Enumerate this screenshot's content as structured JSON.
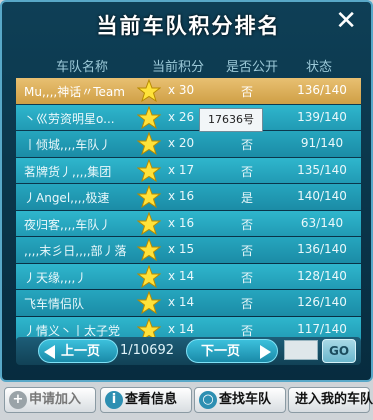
{
  "window": {
    "title": "当前车队积分排名",
    "close_label": "✕"
  },
  "header": {
    "name": "车队名称",
    "score": "当前积分",
    "public": "是否公开",
    "status": "状态"
  },
  "rows": [
    {
      "name": "Mu,,,,神话〃Team",
      "score": "x 30",
      "public": "否",
      "status": "136/140"
    },
    {
      "name": "丶巛劳资明星o...",
      "score": "x 26",
      "public": "否",
      "status": "139/140"
    },
    {
      "name": "丨倾城,,,,车队丿",
      "score": "x 20",
      "public": "否",
      "status": "91/140"
    },
    {
      "name": "茗牌货丿,,,,集团",
      "score": "x 17",
      "public": "否",
      "status": "135/140"
    },
    {
      "name": "丿Angel,,,,极速",
      "score": "x 16",
      "public": "是",
      "status": "140/140"
    },
    {
      "name": "夜归客,,,,车队丿",
      "score": "x 16",
      "public": "否",
      "status": "63/140"
    },
    {
      "name": ",,,,末彡日,,,,部丿落",
      "score": "x 15",
      "public": "否",
      "status": "136/140"
    },
    {
      "name": "丿天缘,,,,丿",
      "score": "x 14",
      "public": "否",
      "status": "128/140"
    },
    {
      "name": "飞车情侣队",
      "score": "x 14",
      "public": "否",
      "status": "126/140"
    },
    {
      "name": "丿情义丶丨太子党",
      "score": "x 14",
      "public": "否",
      "status": "117/140"
    }
  ],
  "tooltip": "17636号",
  "pager": {
    "prev": "上一页",
    "next": "下一页",
    "page_info": "1/10692",
    "go": "GO",
    "page_input": ""
  },
  "bottom": {
    "apply": "申请加入",
    "info": "查看信息",
    "find": "查找车队",
    "mine": "进入我的车队"
  },
  "icons": {
    "star": "star-icon",
    "close": "close-icon",
    "apply": "plus-icon",
    "info": "info-icon",
    "find": "search-icon"
  },
  "colors": {
    "panel": "#0e3f56",
    "row": "#26a6be",
    "selected_row": "#e8c072",
    "star": "#ffe23a"
  }
}
